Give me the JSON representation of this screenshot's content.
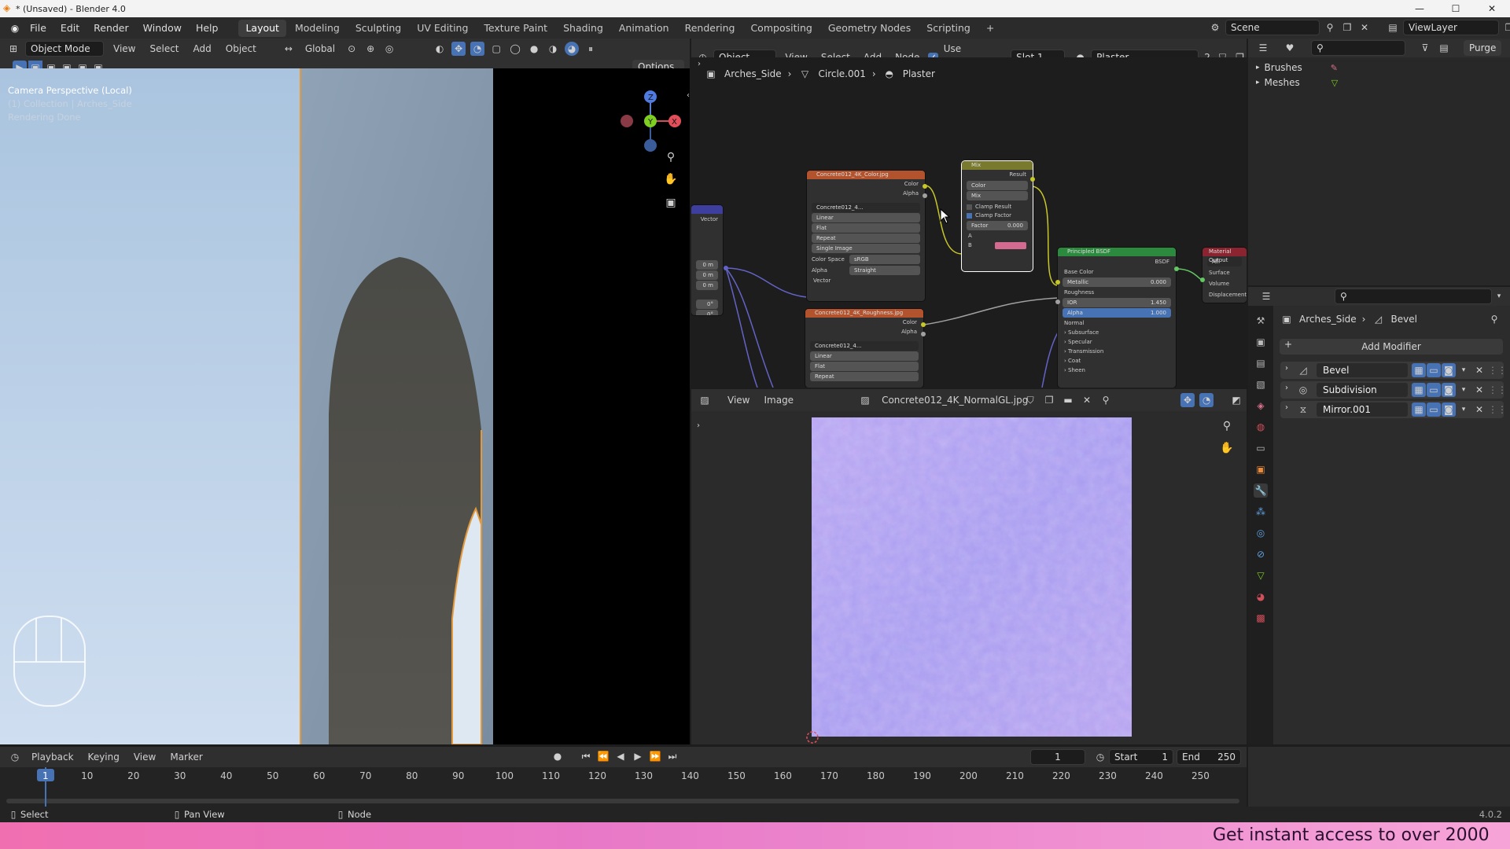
{
  "window": {
    "title": "* (Unsaved) - Blender 4.0"
  },
  "menu": [
    "File",
    "Edit",
    "Render",
    "Window",
    "Help"
  ],
  "workspaces": [
    "Layout",
    "Modeling",
    "Sculpting",
    "UV Editing",
    "Texture Paint",
    "Shading",
    "Animation",
    "Rendering",
    "Compositing",
    "Geometry Nodes",
    "Scripting"
  ],
  "workspace_add": "+",
  "scene": {
    "label": "Scene",
    "view_layer": "ViewLayer"
  },
  "viewport": {
    "mode": "Object Mode",
    "menu": [
      "View",
      "Select",
      "Add",
      "Object"
    ],
    "transform": "Global",
    "options": "Options",
    "overlay_lines": [
      "Camera Perspective (Local)",
      "(1) Collection | Arches_Side",
      "Rendering Done"
    ],
    "axes": {
      "x": "X",
      "y": "Y",
      "z": "Z"
    }
  },
  "node_editor": {
    "object_label": "Object",
    "menu": [
      "View",
      "Select",
      "Add",
      "Node"
    ],
    "use_nodes": "Use Nodes",
    "slot": "Slot 1",
    "material": "Plaster",
    "users": "2",
    "breadcrumb": [
      "Arches_Side",
      "Circle.001",
      "Plaster"
    ],
    "color_node": {
      "title": "Concrete012_4K_Color.jpg",
      "outputs": [
        "Color",
        "Alpha"
      ],
      "image": "Concrete012_4...",
      "fields": [
        "Linear",
        "Flat",
        "Repeat",
        "Single Image"
      ],
      "color_space_label": "Color Space",
      "color_space": "sRGB",
      "alpha_label": "Alpha",
      "alpha": "Straight",
      "input": "Vector"
    },
    "rough_node": {
      "title": "Concrete012_4K_Roughness.jpg",
      "outputs": [
        "Color",
        "Alpha"
      ],
      "image": "Concrete012_4...",
      "fields": [
        "Linear",
        "Flat",
        "Repeat"
      ]
    },
    "mix_node": {
      "title": "Mix",
      "output": "Result",
      "type": "Color",
      "blend": "Mix",
      "clamp_result": "Clamp Result",
      "clamp_factor": "Clamp Factor",
      "factor_label": "Factor",
      "factor": "0.000",
      "a": "A",
      "b": "B",
      "b_color": "#d46a8f"
    },
    "bsdf_node": {
      "title": "Principled BSDF",
      "output": "BSDF",
      "base_color": "Base Color",
      "metallic_label": "Metallic",
      "metallic": "0.000",
      "roughness": "Roughness",
      "ior_label": "IOR",
      "ior": "1.450",
      "alpha_label": "Alpha",
      "alpha": "1.000",
      "normal": "Normal",
      "panels": [
        "Subsurface",
        "Specular",
        "Transmission",
        "Coat",
        "Sheen"
      ]
    },
    "output_node": {
      "title": "Material Output",
      "target": "All",
      "inputs": [
        "Surface",
        "Volume",
        "Displacement"
      ]
    },
    "mapping_node": {
      "title": "",
      "output": "Vector",
      "fields": [
        "0 m",
        "0 m",
        "0 m",
        "0°",
        "0°",
        "0°"
      ]
    }
  },
  "image_editor": {
    "menu": [
      "View",
      "Image"
    ],
    "image_name": "Concrete012_4K_NormalGL.jpg"
  },
  "outliner": {
    "items": [
      "Brushes",
      "Meshes"
    ],
    "purge": "Purge"
  },
  "properties": {
    "breadcrumb": [
      "Arches_Side",
      "Bevel"
    ],
    "add_modifier": "Add Modifier",
    "modifiers": [
      "Bevel",
      "Subdivision",
      "Mirror.001"
    ]
  },
  "timeline": {
    "menu": [
      "Playback",
      "Keying",
      "View",
      "Marker"
    ],
    "current_frame": "1",
    "start_label": "Start",
    "start": "1",
    "end_label": "End",
    "end": "250",
    "ticks": [
      "1",
      "10",
      "20",
      "30",
      "40",
      "50",
      "60",
      "70",
      "80",
      "90",
      "100",
      "110",
      "120",
      "130",
      "140",
      "150",
      "160",
      "170",
      "180",
      "190",
      "200",
      "210",
      "220",
      "230",
      "240",
      "250"
    ]
  },
  "statusbar": {
    "items": [
      "Select",
      "Pan View",
      "Node"
    ],
    "version": "4.0.2"
  },
  "banner": {
    "text": "Get instant access to over 2000"
  }
}
